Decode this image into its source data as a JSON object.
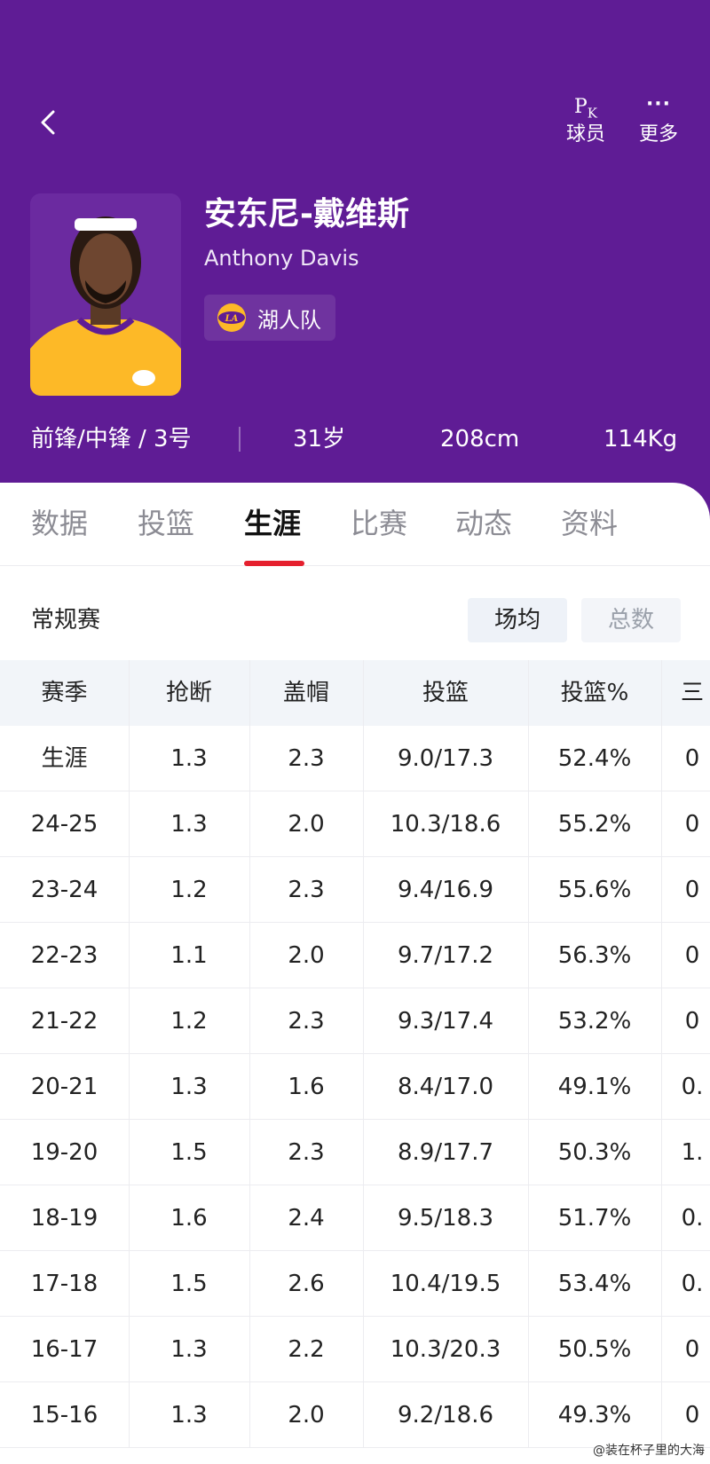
{
  "header": {
    "pk_label": "球员",
    "more_label": "更多",
    "player_name_cn": "安东尼-戴维斯",
    "player_name_en": "Anthony Davis",
    "team_name": "湖人队",
    "position_number": "前锋/中锋 / 3号",
    "age": "31岁",
    "height": "208cm",
    "weight": "114Kg",
    "colors": {
      "purple": "#5f1c95",
      "gold": "#fdb927"
    }
  },
  "tabs": [
    {
      "label": "数据",
      "active": false
    },
    {
      "label": "投篮",
      "active": false
    },
    {
      "label": "生涯",
      "active": true
    },
    {
      "label": "比赛",
      "active": false
    },
    {
      "label": "动态",
      "active": false
    },
    {
      "label": "资料",
      "active": false
    }
  ],
  "section": {
    "title": "常规赛",
    "toggle_per_game": "场均",
    "toggle_total": "总数"
  },
  "table": {
    "columns": [
      "赛季",
      "抢断",
      "盖帽",
      "投篮",
      "投篮%",
      "三"
    ],
    "rows": [
      [
        "生涯",
        "1.3",
        "2.3",
        "9.0/17.3",
        "52.4%",
        "0"
      ],
      [
        "24-25",
        "1.3",
        "2.0",
        "10.3/18.6",
        "55.2%",
        "0"
      ],
      [
        "23-24",
        "1.2",
        "2.3",
        "9.4/16.9",
        "55.6%",
        "0"
      ],
      [
        "22-23",
        "1.1",
        "2.0",
        "9.7/17.2",
        "56.3%",
        "0"
      ],
      [
        "21-22",
        "1.2",
        "2.3",
        "9.3/17.4",
        "53.2%",
        "0"
      ],
      [
        "20-21",
        "1.3",
        "1.6",
        "8.4/17.0",
        "49.1%",
        "0."
      ],
      [
        "19-20",
        "1.5",
        "2.3",
        "8.9/17.7",
        "50.3%",
        "1."
      ],
      [
        "18-19",
        "1.6",
        "2.4",
        "9.5/18.3",
        "51.7%",
        "0."
      ],
      [
        "17-18",
        "1.5",
        "2.6",
        "10.4/19.5",
        "53.4%",
        "0."
      ],
      [
        "16-17",
        "1.3",
        "2.2",
        "10.3/20.3",
        "50.5%",
        "0"
      ],
      [
        "15-16",
        "1.3",
        "2.0",
        "9.2/18.6",
        "49.3%",
        "0"
      ]
    ]
  },
  "watermark": "@装在杯子里的大海"
}
